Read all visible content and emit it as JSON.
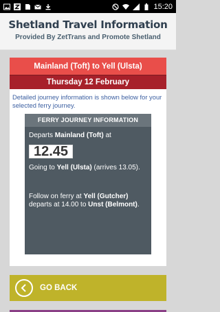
{
  "status_bar": {
    "time": "15:20",
    "left_icons": [
      "image-icon",
      "zettrans-icon",
      "sd-card-icon",
      "mail-icon",
      "download-icon"
    ],
    "right_icons": [
      "do-not-disturb-icon",
      "wifi-icon",
      "signal-icon",
      "battery-icon"
    ]
  },
  "header": {
    "title": "Shetland Travel Information",
    "subtitle": "Provided By ZetTrans and Promote Shetland"
  },
  "journey": {
    "route": "Mainland (Toft) to Yell (Ulsta)",
    "date": "Thursday 12 February",
    "intro": "Detailed journey information is shown below for your selected ferry journey.",
    "panel_title": "FERRY JOURNEY INFORMATION",
    "departs_prefix": "Departs ",
    "departs_place": "Mainland (Toft)",
    "departs_suffix": " at",
    "depart_time": "12.45",
    "going_prefix": "Going to ",
    "going_place": "Yell (Ulsta)",
    "going_suffix": " (arrives 13.05).",
    "follow_prefix": "Follow on ferry at ",
    "follow_place": "Yell (Gutcher)",
    "follow_mid": " departs at 14.00 to ",
    "follow_dest": "Unst (Belmont)",
    "follow_end": "."
  },
  "actions": {
    "go_back_label": "GO BACK"
  },
  "colors": {
    "route_bar": "#e94e4a",
    "date_bar": "#a7202a",
    "info_panel": "#4f5a62",
    "go_back": "#bfb32a"
  }
}
